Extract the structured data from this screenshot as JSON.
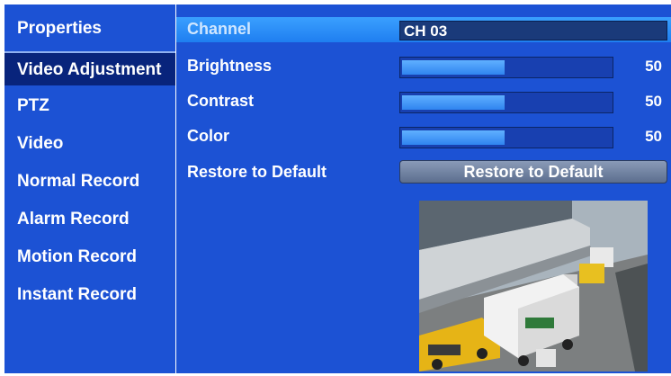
{
  "sidebar": {
    "items": [
      {
        "label": "Properties"
      },
      {
        "label": "Video Adjustment"
      },
      {
        "label": "PTZ"
      },
      {
        "label": "Video"
      },
      {
        "label": "Normal Record"
      },
      {
        "label": "Alarm Record"
      },
      {
        "label": "Motion Record"
      },
      {
        "label": "Instant Record"
      }
    ],
    "selected_index": 1
  },
  "main": {
    "channel": {
      "label": "Channel",
      "value": "CH 03"
    },
    "brightness": {
      "label": "Brightness",
      "value": "50",
      "level": 0.5
    },
    "contrast": {
      "label": "Contrast",
      "value": "50",
      "level": 0.5
    },
    "color": {
      "label": "Color",
      "value": "50",
      "level": 0.5
    },
    "restore": {
      "label": "Restore to Default",
      "button_label": "Restore to Default"
    }
  },
  "colors": {
    "panel_bg": "#1c52d4",
    "selected_item": "#08247c",
    "channel_row": "#3aa0ff",
    "slider_fill": "#5fb0ff"
  }
}
